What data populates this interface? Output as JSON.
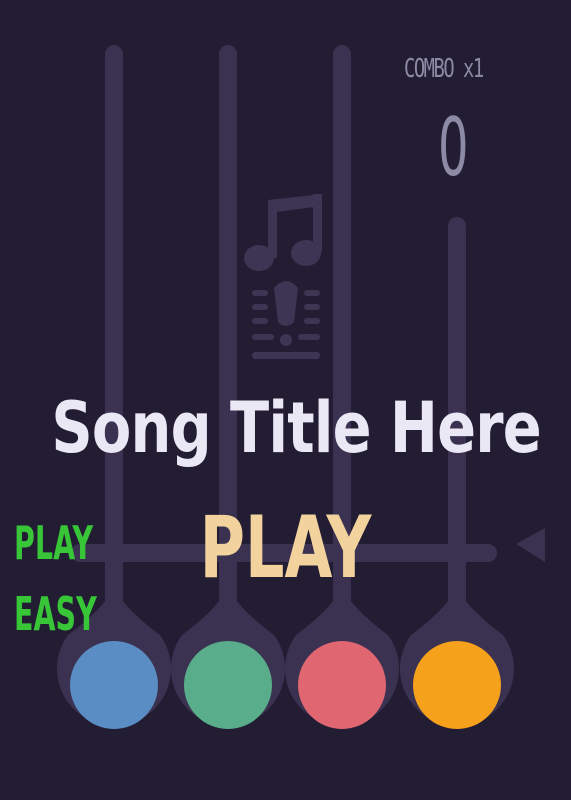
{
  "hud": {
    "combo_text": "COMBO x1",
    "score": "0"
  },
  "song": {
    "title": "Song Title Here"
  },
  "main_button": {
    "label": "PLAY"
  },
  "side_menu": {
    "play_label": "PLAY",
    "difficulty_label": "EASY"
  },
  "buttons": [
    {
      "name": "blue-button",
      "color": "#5a8dc4"
    },
    {
      "name": "green-button",
      "color": "#5aad8b"
    },
    {
      "name": "red-button",
      "color": "#e06671"
    },
    {
      "name": "orange-button",
      "color": "#f6a11c"
    }
  ],
  "colors": {
    "background": "#221d33",
    "lane": "#3a3250",
    "icon": "#3e3554",
    "title": "#ebe8f6",
    "play": "#f3d39d",
    "side_menu": "#38c538",
    "hud": "#8d8aa6"
  },
  "icons": [
    "music-note-icon",
    "microphone-icon",
    "lane-pointer-icon"
  ]
}
